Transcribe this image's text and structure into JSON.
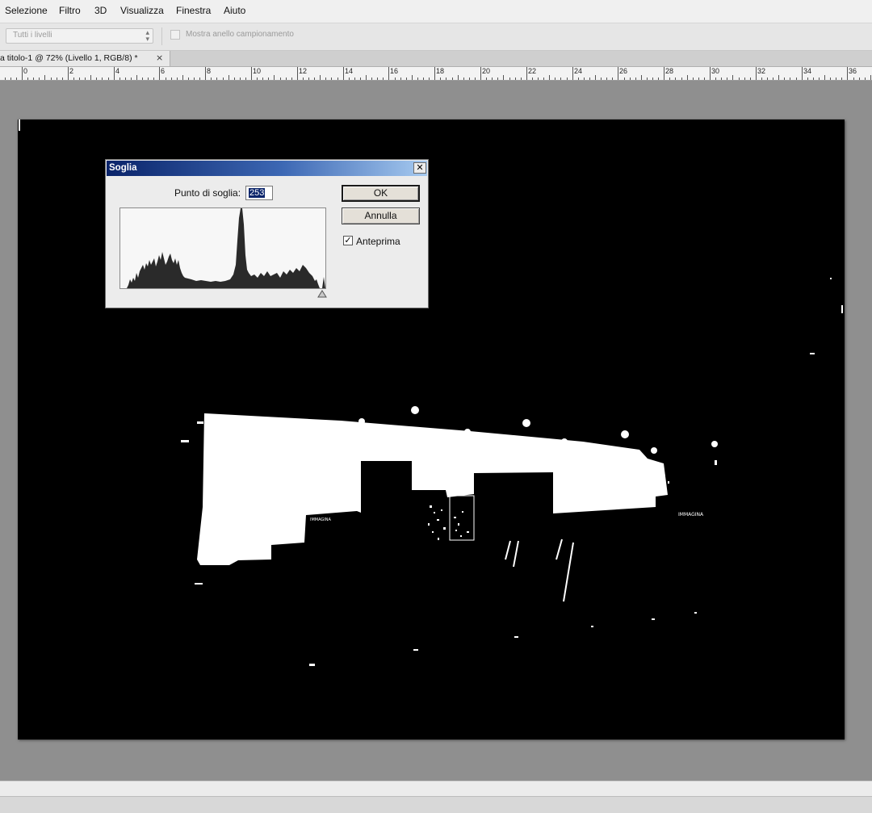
{
  "menu": {
    "items": [
      "Selezione",
      "Filtro",
      "3D",
      "Visualizza",
      "Finestra",
      "Aiuto"
    ]
  },
  "options_bar": {
    "sample_select_value": "Tutti i livelli",
    "show_ring_label": "Mostra anello campionamento",
    "show_ring_checked": false
  },
  "document_tab": {
    "title": "a titolo-1 @ 72% (Livello 1, RGB/8) *",
    "close_glyph": "×"
  },
  "ruler": {
    "labels": [
      "0",
      "2",
      "4",
      "6",
      "8",
      "10",
      "12",
      "14",
      "16",
      "18",
      "20",
      "22",
      "24",
      "26",
      "28",
      "30",
      "32",
      "34",
      "36"
    ]
  },
  "dialog": {
    "title": "Soglia",
    "close_glyph": "✕",
    "threshold_label": "Punto di soglia:",
    "threshold_value": "253",
    "ok_label": "OK",
    "cancel_label": "Annulla",
    "preview_label": "Anteprima",
    "preview_checked": true,
    "preview_check_glyph": "✓"
  },
  "canvas_text": {
    "sign_left": "IMMAGINA",
    "sign_right": "IMMAGINA"
  },
  "colors": {
    "dialog_title_start": "#0a246a",
    "dialog_title_end": "#a6caf0",
    "canvas_background": "#000000",
    "workspace_background": "#8f8f8f"
  }
}
